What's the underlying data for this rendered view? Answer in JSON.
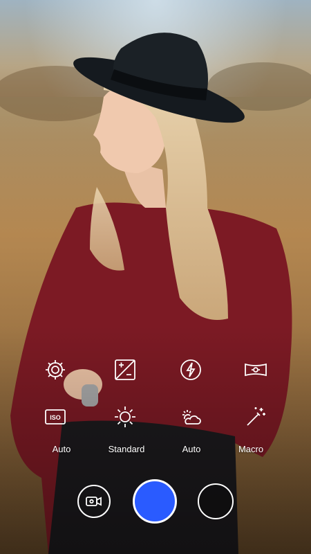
{
  "camera": {
    "settings_row": {
      "icons": [
        "gear-icon",
        "exposure-compensation-icon",
        "flash-auto-icon",
        "panorama-icon"
      ]
    },
    "modes_row": {
      "icons": [
        "iso-icon",
        "brightness-icon",
        "weather-auto-icon",
        "magic-wand-icon"
      ],
      "iso_badge": "ISO",
      "labels": [
        "Auto",
        "Standard",
        "Auto",
        "Macro"
      ]
    },
    "controls": {
      "shutter_color": "#2a5bff",
      "video_icon": "video-camera-icon"
    }
  }
}
